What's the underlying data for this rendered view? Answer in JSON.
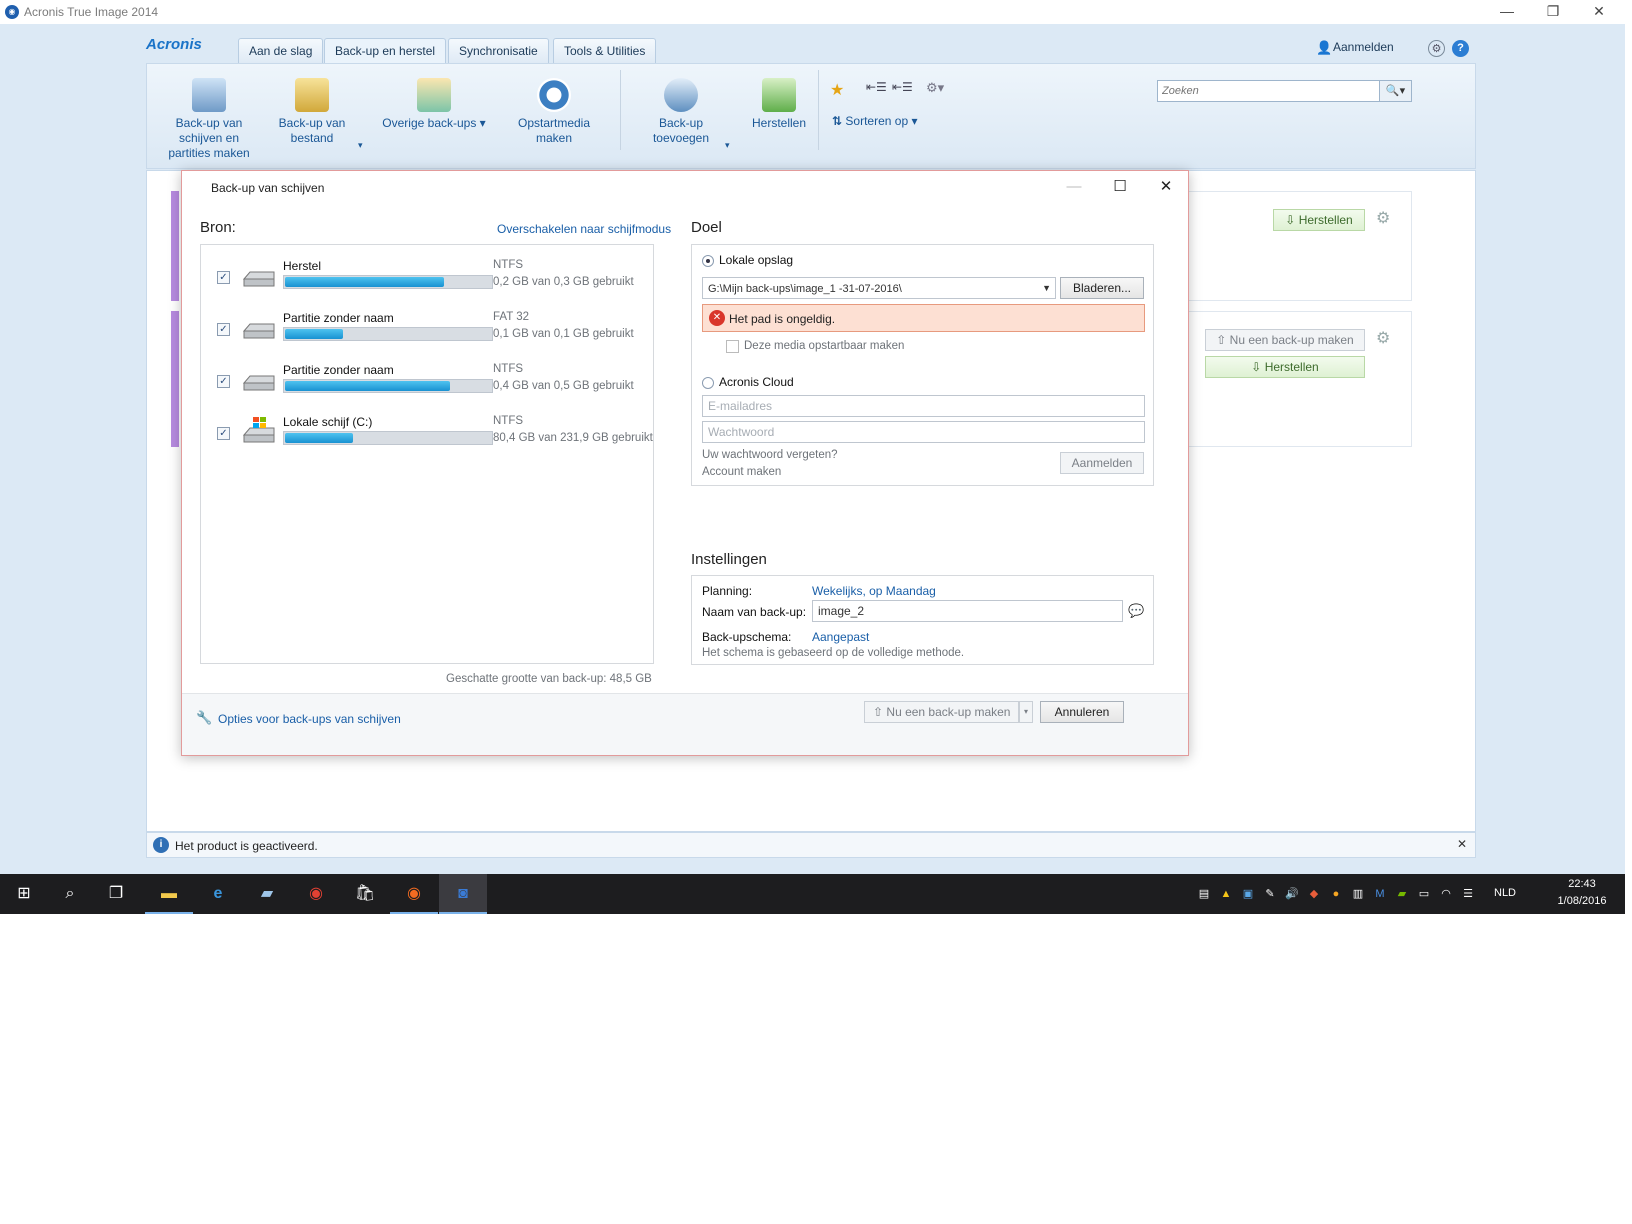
{
  "window": {
    "title": "Acronis True Image 2014",
    "logo": "Acronis",
    "tabs": [
      "Aan de slag",
      "Back-up en herstel",
      "Synchronisatie",
      "Tools & Utilities"
    ],
    "signin": "Aanmelden"
  },
  "ribbon": {
    "disk_backup": "Back-up van schijven en partities maken",
    "file_backup": "Back-up van bestand",
    "other_backups": "Overige back-ups",
    "boot_media": "Opstartmedia maken",
    "add_backup": "Back-up toevoegen",
    "restore": "Herstellen",
    "sort": "Sorteren op",
    "search_placeholder": "Zoeken"
  },
  "background_cards": {
    "card1_restore": "Herstellen",
    "card2_backup_now": "Nu een back-up maken",
    "card2_restore": "Herstellen"
  },
  "status": {
    "message": "Het product is geactiveerd."
  },
  "dialog": {
    "title": "Back-up van schijven",
    "source_label": "Bron:",
    "switch_mode": "Overschakelen naar schijfmodus",
    "partitions": [
      {
        "name": "Herstel",
        "fs": "NTFS",
        "usage": "0,2 GB van 0,3 GB gebruikt",
        "fill": 0.77
      },
      {
        "name": "Partitie zonder naam",
        "fs": "FAT 32",
        "usage": "0,1 GB van 0,1 GB gebruikt",
        "fill": 0.28
      },
      {
        "name": "Partitie zonder naam",
        "fs": "NTFS",
        "usage": "0,4 GB van 0,5 GB gebruikt",
        "fill": 0.8
      },
      {
        "name": "Lokale schijf (C:)",
        "fs": "NTFS",
        "usage": "80,4 GB van 231,9 GB gebruikt",
        "fill": 0.33
      }
    ],
    "estimate": "Geschatte grootte van back-up: 48,5 GB",
    "target_label": "Doel",
    "local_storage": "Lokale opslag",
    "path_value": "G:\\Mijn back-ups\\image_1 -31-07-2016\\",
    "browse": "Bladeren...",
    "error": "Het pad is ongeldig.",
    "bootable": "Deze media opstartbaar maken",
    "cloud": "Acronis Cloud",
    "email_placeholder": "E-mailadres",
    "password_placeholder": "Wachtwoord",
    "forgot": "Uw wachtwoord vergeten?",
    "create_account": "Account maken",
    "login": "Aanmelden",
    "settings_label": "Instellingen",
    "schedule_label": "Planning:",
    "schedule_value": "Wekelijks, op Maandag",
    "name_label": "Naam van back-up:",
    "name_value": "image_2",
    "scheme_label": "Back-upschema:",
    "scheme_value": "Aangepast",
    "scheme_note": "Het schema is gebaseerd op de volledige methode.",
    "options": "Opties voor back-ups van schijven",
    "backup_now": "Nu een back-up maken",
    "cancel": "Annuleren"
  },
  "taskbar": {
    "language": "NLD",
    "time": "22:43",
    "date": "1/08/2016"
  },
  "colors": {
    "accent": "#1a5fa8",
    "progress": "#1992d1",
    "error_bg": "#fde0d3",
    "ribbon_bg": "#dce9f5"
  }
}
